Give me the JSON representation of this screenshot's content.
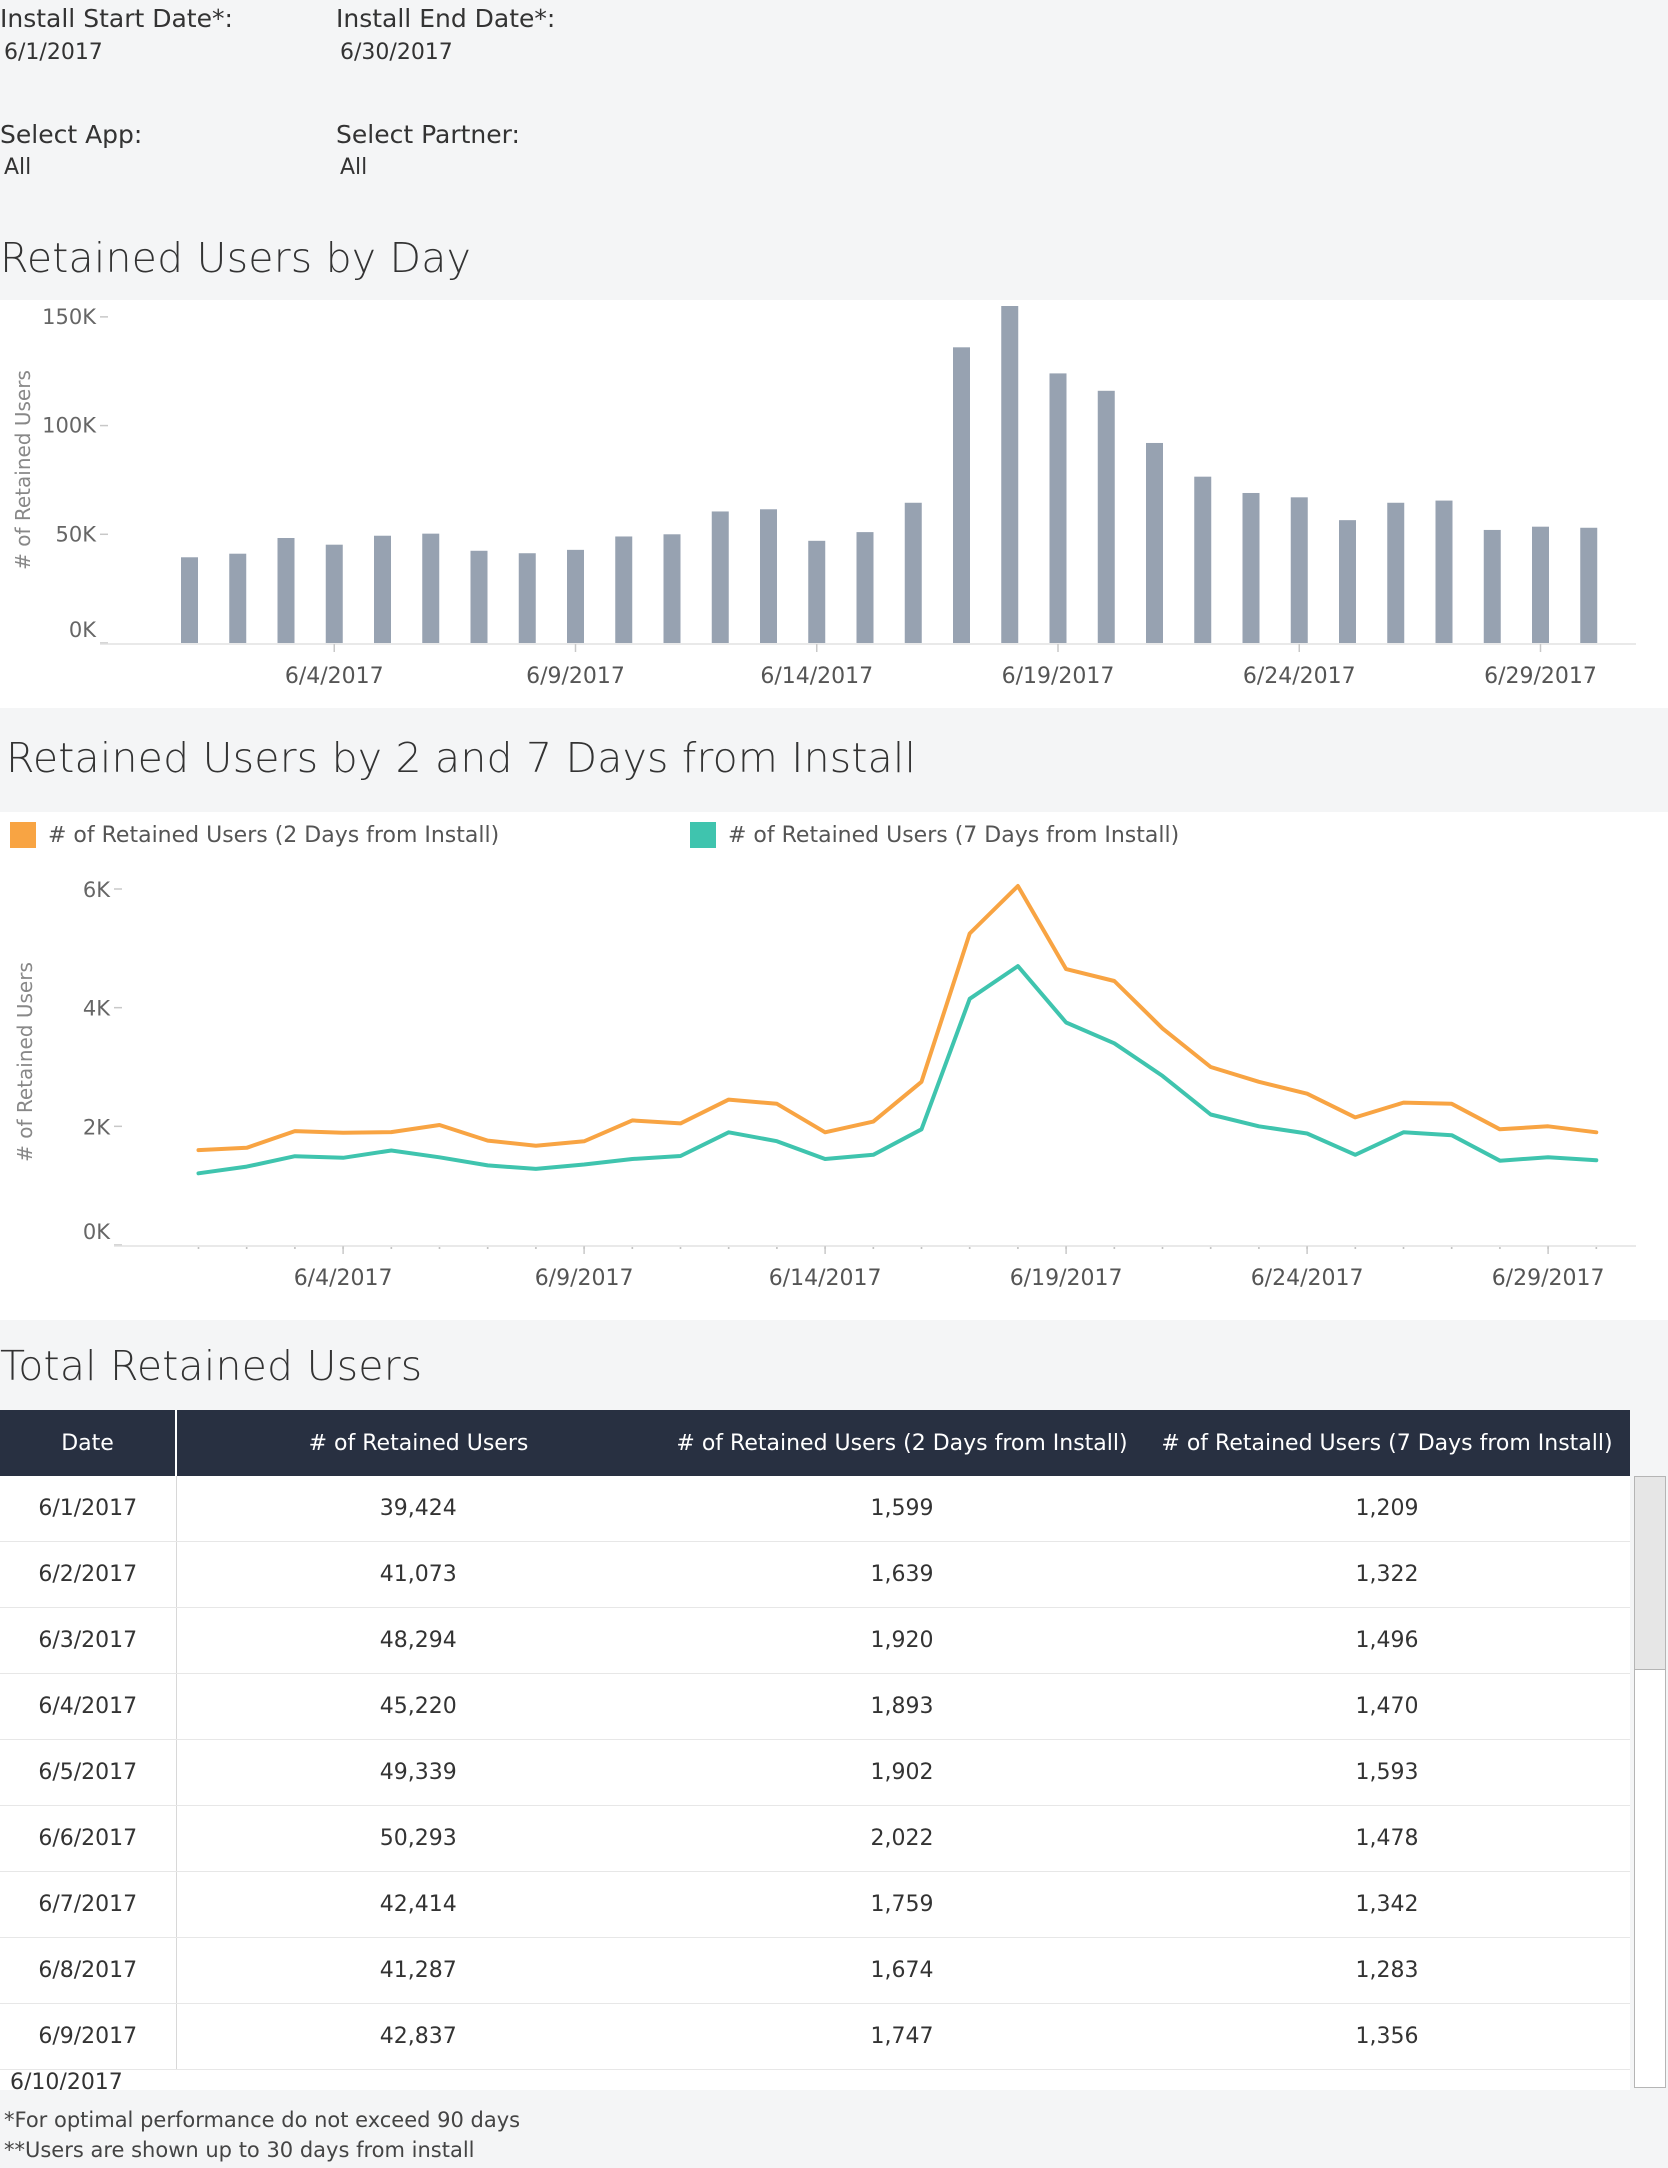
{
  "filters": {
    "start_date_label": "Install Start Date*:",
    "start_date_value": "6/1/2017",
    "end_date_label": "Install End Date*:",
    "end_date_value": "6/30/2017",
    "app_label": "Select App:",
    "app_value": "All",
    "partner_label": "Select Partner:",
    "partner_value": "All"
  },
  "chart1": {
    "title": "Retained Users by Day",
    "ylabel": "# of Retained Users",
    "yticks": [
      "150K",
      "100K",
      "50K",
      "0K"
    ],
    "xticks": [
      "6/4/2017",
      "6/9/2017",
      "6/14/2017",
      "6/19/2017",
      "6/24/2017",
      "6/29/2017"
    ],
    "bar_color": "#97a2b1"
  },
  "chart2": {
    "title": "Retained Users by 2 and 7 Days from Install",
    "ylabel": "# of Retained Users",
    "yticks": [
      "6K",
      "4K",
      "2K",
      "0K"
    ],
    "xticks": [
      "6/4/2017",
      "6/9/2017",
      "6/14/2017",
      "6/19/2017",
      "6/24/2017",
      "6/29/2017"
    ],
    "legend": [
      {
        "label": "# of Retained Users (2 Days from Install)",
        "color": "#f8a443"
      },
      {
        "label": "# of Retained Users (7 Days from Install)",
        "color": "#3fc4ae"
      }
    ]
  },
  "chart_data": [
    {
      "type": "bar",
      "title": "Retained Users by Day",
      "ylabel": "# of Retained Users",
      "xlabel": "",
      "ylim": [
        0,
        155000
      ],
      "grid": false,
      "categories": [
        "6/1/2017",
        "6/2/2017",
        "6/3/2017",
        "6/4/2017",
        "6/5/2017",
        "6/6/2017",
        "6/7/2017",
        "6/8/2017",
        "6/9/2017",
        "6/10/2017",
        "6/11/2017",
        "6/12/2017",
        "6/13/2017",
        "6/14/2017",
        "6/15/2017",
        "6/16/2017",
        "6/17/2017",
        "6/18/2017",
        "6/19/2017",
        "6/20/2017",
        "6/21/2017",
        "6/22/2017",
        "6/23/2017",
        "6/24/2017",
        "6/25/2017",
        "6/26/2017",
        "6/27/2017",
        "6/28/2017",
        "6/29/2017",
        "6/30/2017"
      ],
      "values": [
        39424,
        41073,
        48294,
        45220,
        49339,
        50293,
        42414,
        41287,
        42837,
        49000,
        50000,
        60500,
        61500,
        47000,
        51000,
        64500,
        136000,
        155000,
        124000,
        116000,
        92000,
        76500,
        69000,
        67000,
        56500,
        64500,
        65500,
        52000,
        53500,
        53000
      ]
    },
    {
      "type": "line",
      "title": "Retained Users by 2 and 7 Days from Install",
      "ylabel": "# of Retained Users",
      "xlabel": "",
      "ylim": [
        0,
        6200
      ],
      "grid": false,
      "legend": "top",
      "x": [
        "6/1/2017",
        "6/2/2017",
        "6/3/2017",
        "6/4/2017",
        "6/5/2017",
        "6/6/2017",
        "6/7/2017",
        "6/8/2017",
        "6/9/2017",
        "6/10/2017",
        "6/11/2017",
        "6/12/2017",
        "6/13/2017",
        "6/14/2017",
        "6/15/2017",
        "6/16/2017",
        "6/17/2017",
        "6/18/2017",
        "6/19/2017",
        "6/20/2017",
        "6/21/2017",
        "6/22/2017",
        "6/23/2017",
        "6/24/2017",
        "6/25/2017",
        "6/26/2017",
        "6/27/2017",
        "6/28/2017",
        "6/29/2017",
        "6/30/2017"
      ],
      "series": [
        {
          "name": "# of Retained Users (2 Days from Install)",
          "color": "#f8a443",
          "values": [
            1599,
            1639,
            1920,
            1893,
            1902,
            2022,
            1759,
            1674,
            1747,
            2100,
            2050,
            2450,
            2380,
            1900,
            2080,
            2750,
            5250,
            6050,
            4650,
            4450,
            3650,
            3000,
            2750,
            2550,
            2150,
            2400,
            2380,
            1950,
            2000,
            1900
          ]
        },
        {
          "name": "# of Retained Users (7 Days from Install)",
          "color": "#3fc4ae",
          "values": [
            1209,
            1322,
            1496,
            1470,
            1593,
            1478,
            1342,
            1283,
            1356,
            1450,
            1500,
            1900,
            1750,
            1450,
            1520,
            1950,
            4150,
            4700,
            3750,
            3400,
            2850,
            2200,
            2000,
            1880,
            1520,
            1900,
            1850,
            1420,
            1480,
            1430
          ]
        }
      ]
    }
  ],
  "table": {
    "title": "Total Retained Users",
    "columns": [
      "Date",
      "# of Retained Users",
      "# of Retained Users (2 Days from Install)",
      "# of Retained Users (7 Days from Install)"
    ],
    "rows": [
      [
        "6/1/2017",
        "39,424",
        "1,599",
        "1,209"
      ],
      [
        "6/2/2017",
        "41,073",
        "1,639",
        "1,322"
      ],
      [
        "6/3/2017",
        "48,294",
        "1,920",
        "1,496"
      ],
      [
        "6/4/2017",
        "45,220",
        "1,893",
        "1,470"
      ],
      [
        "6/5/2017",
        "49,339",
        "1,902",
        "1,593"
      ],
      [
        "6/6/2017",
        "50,293",
        "2,022",
        "1,478"
      ],
      [
        "6/7/2017",
        "42,414",
        "1,759",
        "1,342"
      ],
      [
        "6/8/2017",
        "41,287",
        "1,674",
        "1,283"
      ],
      [
        "6/9/2017",
        "42,837",
        "1,747",
        "1,356"
      ]
    ],
    "partial_row_date": "6/10/2017"
  },
  "footnotes": {
    "note1": "*For optimal performance do not exceed 90 days",
    "note2": "**Users are shown up to 30 days from install"
  }
}
